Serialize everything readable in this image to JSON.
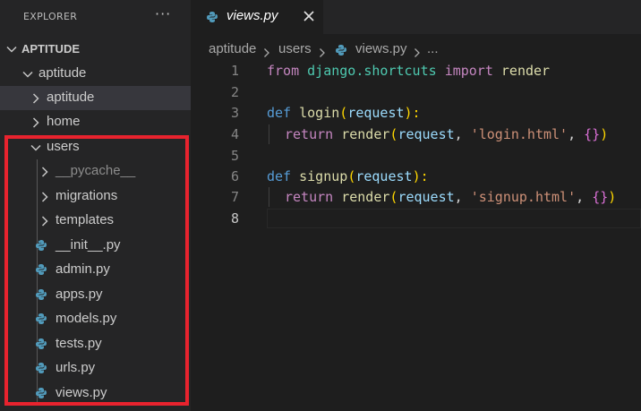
{
  "explorer": {
    "title": "EXPLORER",
    "more": "···",
    "project": "APTITUDE",
    "tree": {
      "aptitude_root": "aptitude",
      "aptitude_sub": "aptitude",
      "home": "home",
      "users": "users",
      "pycache": "__pycache__",
      "migrations": "migrations",
      "templates": "templates",
      "init": "__init__.py",
      "admin": "admin.py",
      "apps": "apps.py",
      "models": "models.py",
      "tests": "tests.py",
      "urls": "urls.py",
      "views": "views.py"
    }
  },
  "tab": {
    "label": "views.py"
  },
  "breadcrumb": {
    "c1": "aptitude",
    "c2": "users",
    "c3": "views.py",
    "c4": "..."
  },
  "editor": {
    "line_numbers": [
      "1",
      "2",
      "3",
      "4",
      "5",
      "6",
      "7",
      "8"
    ],
    "l1": {
      "from": "from",
      "module": "django.shortcuts",
      "import": "import",
      "name": "render"
    },
    "l3": {
      "def": "def",
      "fn": "login",
      "open": "(",
      "param": "request",
      "close": "):"
    },
    "l4": {
      "return": "return",
      "fn": "render",
      "open": "(",
      "param": "request",
      "comma1": ", ",
      "str": "'login.html'",
      "comma2": ", ",
      "dict": "{}",
      "close": ")"
    },
    "l6": {
      "def": "def",
      "fn": "signup",
      "open": "(",
      "param": "request",
      "close": "):"
    },
    "l7": {
      "return": "return",
      "fn": "render",
      "open": "(",
      "param": "request",
      "comma1": ", ",
      "str": "'signup.html'",
      "comma2": ", ",
      "dict": "{}",
      "close": ")"
    }
  },
  "colors": {
    "highlight_box": "#e8232e",
    "python_icon": "#519aba",
    "selected_row": "#37373d"
  },
  "icons": {
    "python": "python-file-icon",
    "chevron_right": "chevron-right-icon",
    "chevron_down": "chevron-down-icon",
    "close": "close-icon"
  }
}
